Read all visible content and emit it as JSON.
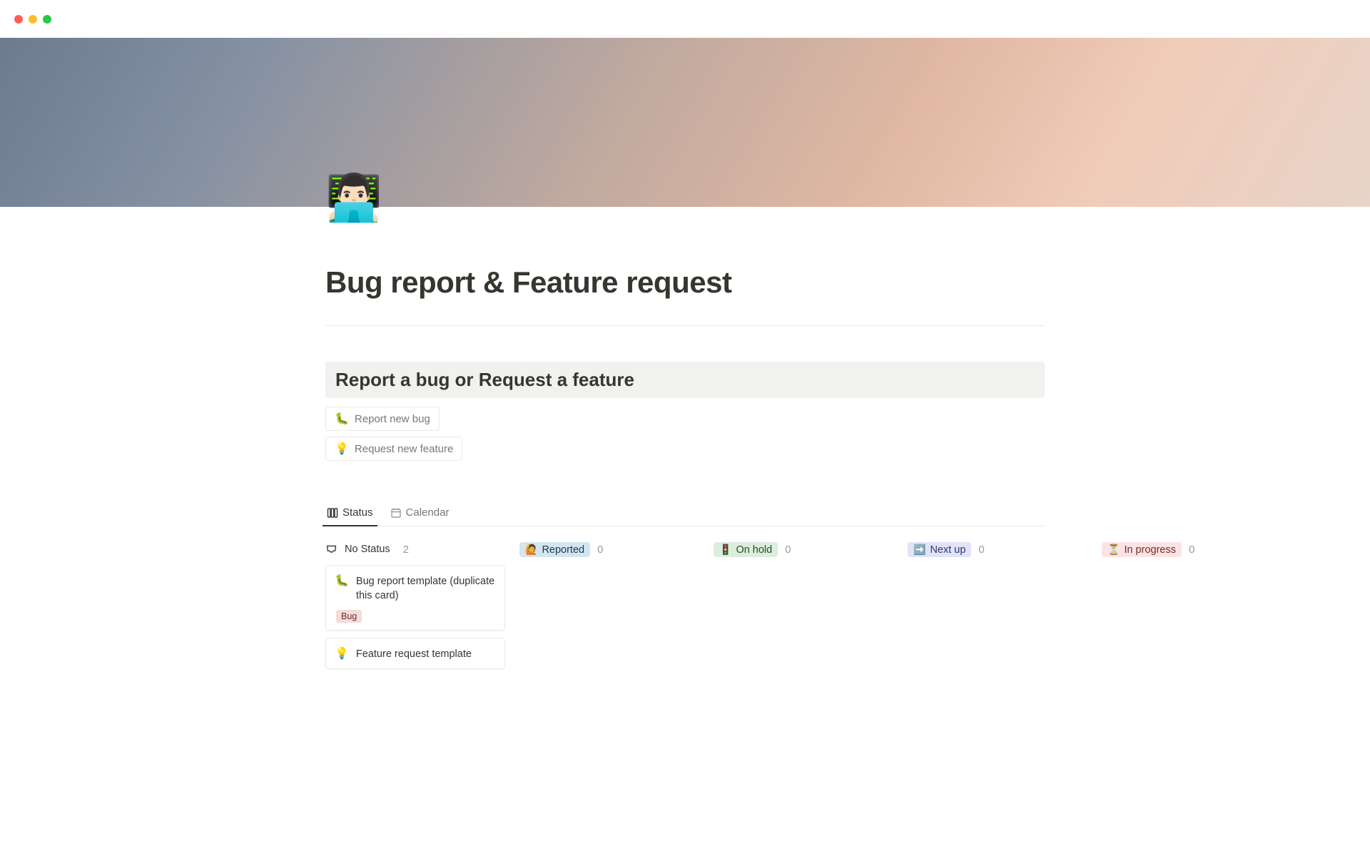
{
  "page": {
    "icon": "👨🏻‍💻",
    "title": "Bug report & Feature request"
  },
  "heading": {
    "title": "Report a bug or Request a feature"
  },
  "actions": {
    "report_bug": {
      "emoji": "🐛",
      "label": "Report new bug"
    },
    "request_feature": {
      "emoji": "💡",
      "label": "Request new feature"
    }
  },
  "views": {
    "status": "Status",
    "calendar": "Calendar"
  },
  "columns": [
    {
      "id": "no-status",
      "label": "No Status",
      "count": "2",
      "pill_class": "pill-none",
      "emoji": ""
    },
    {
      "id": "reported",
      "label": "Reported",
      "count": "0",
      "pill_class": "pill-blue",
      "emoji": "🙋"
    },
    {
      "id": "on-hold",
      "label": "On hold",
      "count": "0",
      "pill_class": "pill-olive",
      "emoji": "🚦"
    },
    {
      "id": "next-up",
      "label": "Next up",
      "count": "0",
      "pill_class": "pill-indigo",
      "emoji": "➡️"
    },
    {
      "id": "in-progress",
      "label": "In progress",
      "count": "0",
      "pill_class": "pill-pink",
      "emoji": "⏳"
    }
  ],
  "cards": {
    "bug_template": {
      "emoji": "🐛",
      "title": "Bug report template (duplicate this card)",
      "tag": "Bug"
    },
    "feature_template": {
      "emoji": "💡",
      "title": "Feature request template"
    }
  }
}
